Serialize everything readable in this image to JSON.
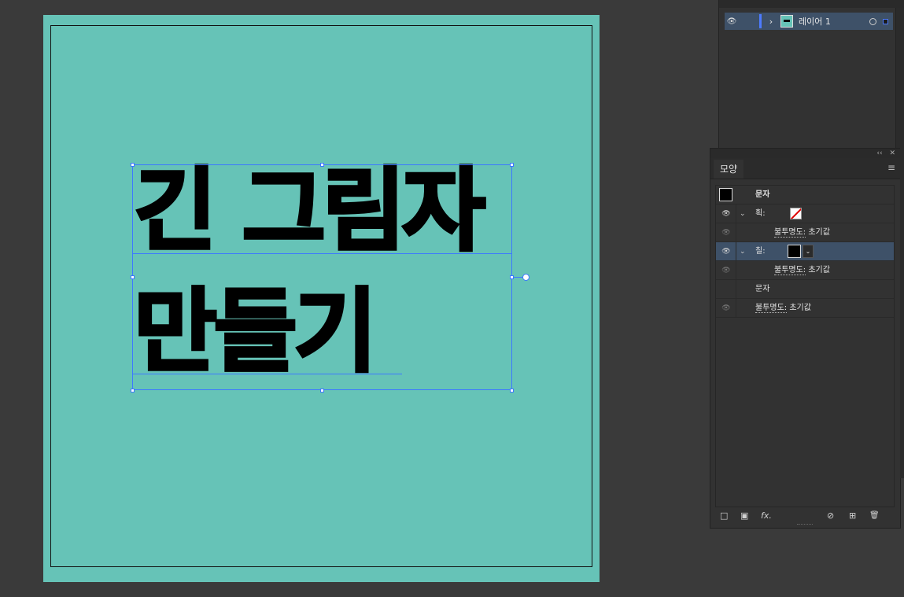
{
  "artboard": {
    "text_line1": "긴 그림자",
    "text_line2": "만들기",
    "background_color": "#66c3b7",
    "selection_color": "#3c78ff"
  },
  "layers_panel": {
    "layer_name": "레이어 1",
    "eye_icon": "eye-icon",
    "expand_icon": "chevron-right-icon",
    "layer_color": "#4d7bff"
  },
  "appearance_panel": {
    "collapse_label": "‹‹",
    "close_label": "✕",
    "tab_label": "모양",
    "menu_icon": "≡",
    "rows": {
      "header_label": "문자",
      "stroke_label": "획:",
      "stroke_opacity_label": "불투명도:",
      "stroke_opacity_value": "초기값",
      "fill_label": "칠:",
      "fill_opacity_label": "불투명도:",
      "fill_opacity_value": "초기값",
      "characters_label": "문자",
      "opacity_label": "불투명도:",
      "opacity_value": "초기값"
    },
    "footer": {
      "add_stroke_icon": "□",
      "add_fill_icon": "▣",
      "fx_label": "fx.",
      "clear_icon": "⊘",
      "duplicate_icon": "⊞",
      "delete_icon": "🗑"
    }
  },
  "glyphs": {
    "eye": "👁",
    "chevron_right": "›",
    "chevron_down": "⌄"
  }
}
